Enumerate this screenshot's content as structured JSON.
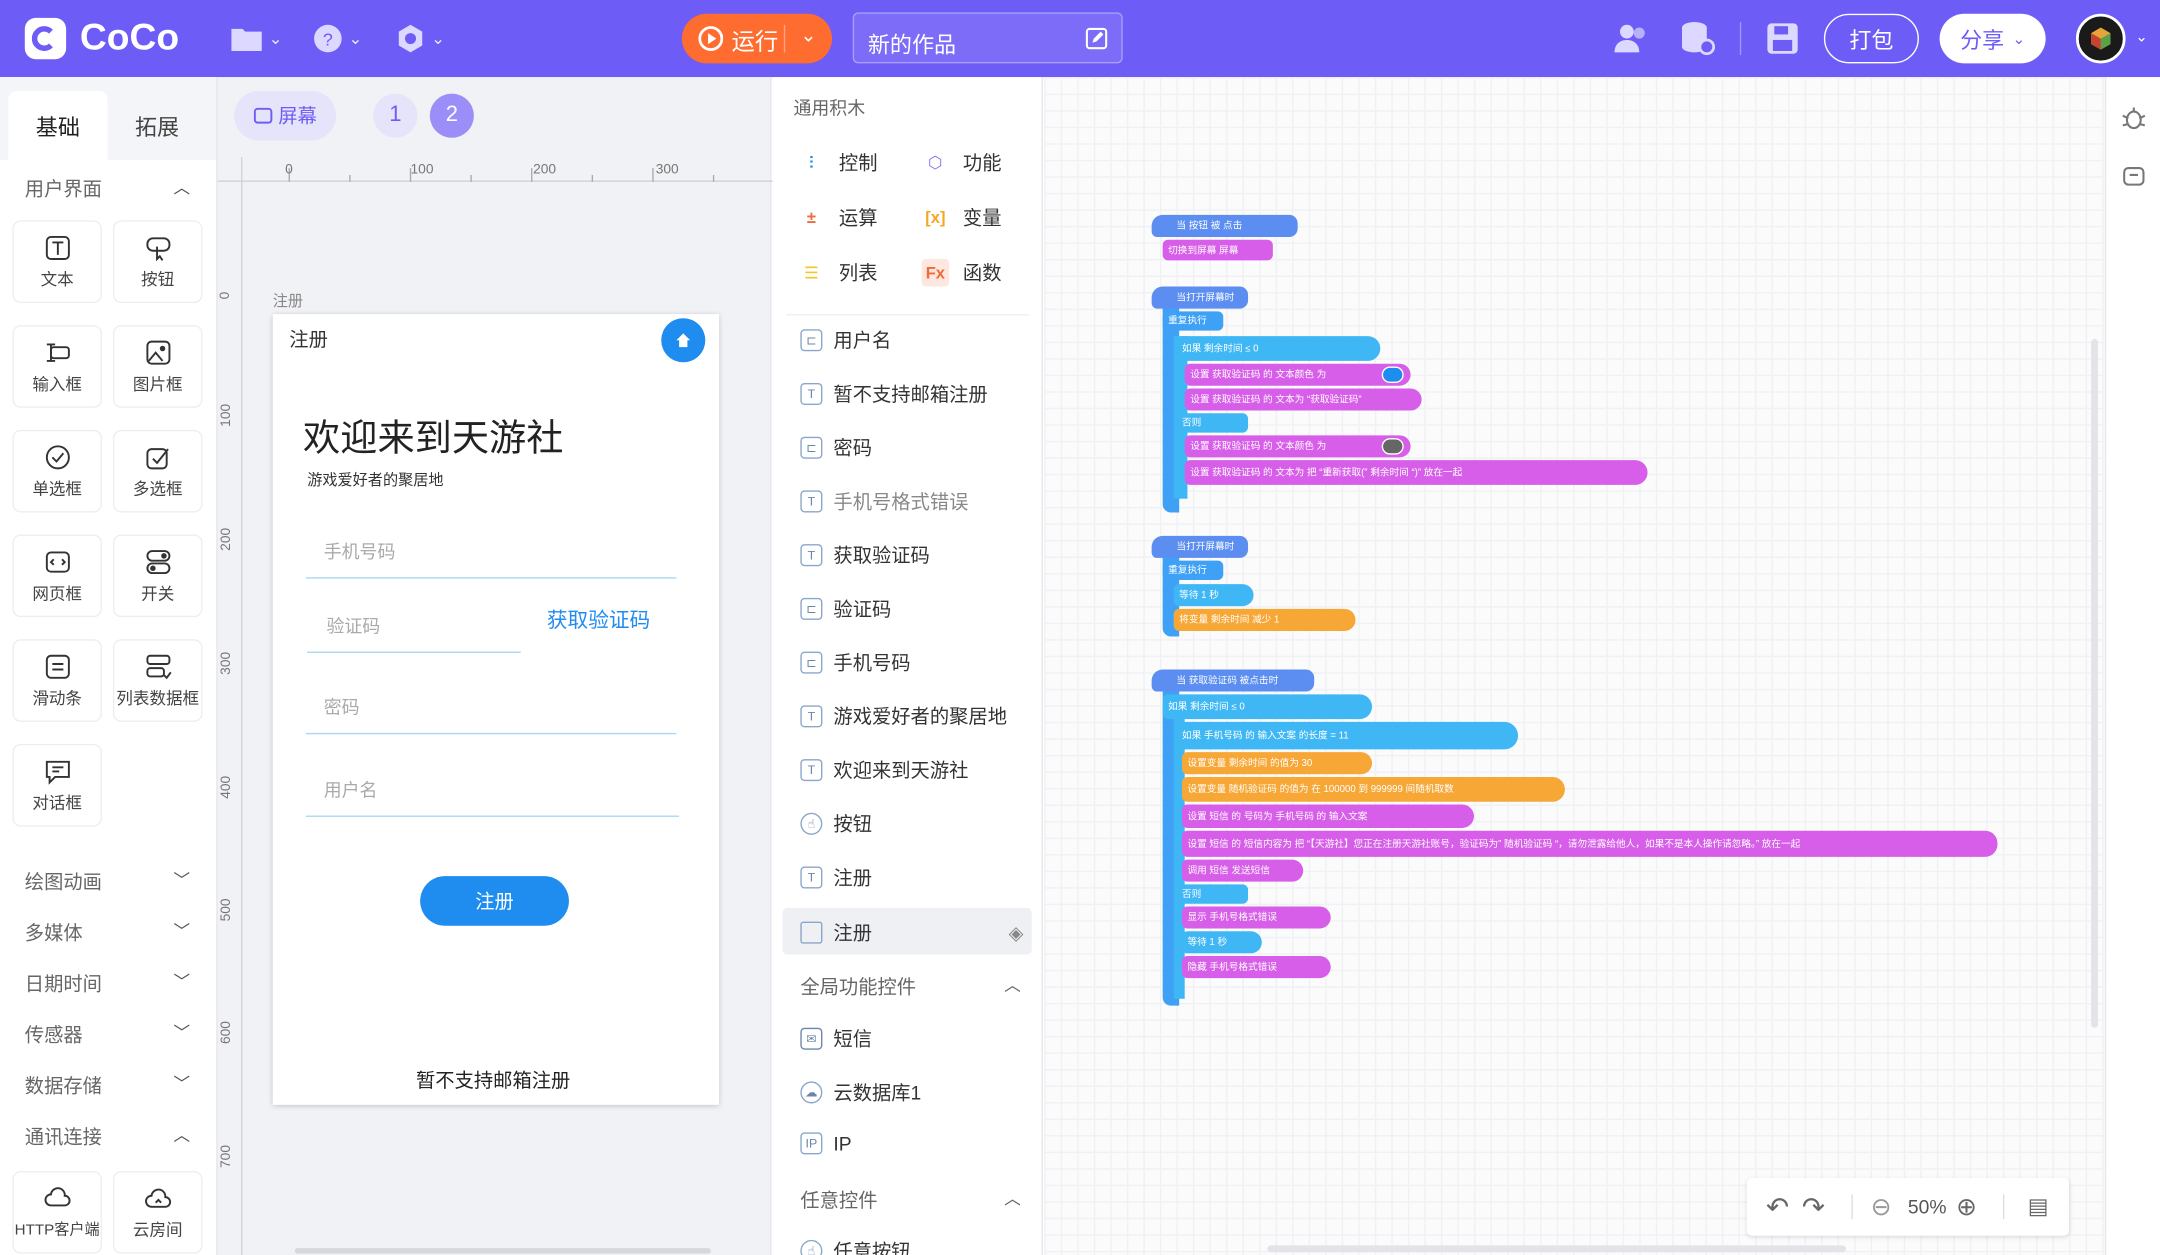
{
  "app": {
    "name": "CoCo"
  },
  "topbar": {
    "run_label": "运行",
    "project_title": "新的作品",
    "pack_label": "打包",
    "share_label": "分享"
  },
  "left_panel": {
    "tabs": [
      "基础",
      "拓展"
    ],
    "sections": {
      "ui": "用户界面",
      "draw": "绘图动画",
      "media": "多媒体",
      "datetime": "日期时间",
      "sensor": "传感器",
      "storage": "数据存储",
      "network": "通讯连接"
    },
    "components": [
      "文本",
      "按钮",
      "输入框",
      "图片框",
      "单选框",
      "多选框",
      "网页框",
      "开关",
      "滑动条",
      "列表数据框",
      "对话框"
    ],
    "network_components": [
      "HTTP客户端",
      "云房间"
    ]
  },
  "canvas": {
    "screen_label": "屏幕",
    "pages": [
      "1",
      "2"
    ],
    "ruler_h": [
      "0",
      "100",
      "200",
      "300"
    ],
    "ruler_v": [
      "0",
      "100",
      "200",
      "300",
      "400",
      "500",
      "600",
      "700"
    ],
    "screen_name": "注册"
  },
  "phone": {
    "header_title": "注册",
    "welcome": "欢迎来到天游社",
    "subtitle": "游戏爱好者的聚居地",
    "phone_placeholder": "手机号码",
    "code_placeholder": "验证码",
    "get_code": "获取验证码",
    "password_placeholder": "密码",
    "username_placeholder": "用户名",
    "register_button": "注册",
    "email_note": "暂不支持邮箱注册"
  },
  "blocks_panel": {
    "header": "通用积木",
    "categories": [
      "控制",
      "功能",
      "运算",
      "变量",
      "列表",
      "函数"
    ],
    "items": [
      "用户名",
      "暂不支持邮箱注册",
      "密码",
      "手机号格式错误",
      "获取验证码",
      "验证码",
      "手机号码",
      "游戏爱好者的聚居地",
      "欢迎来到天游社",
      "按钮",
      "注册",
      "注册"
    ],
    "global_section": "全局功能控件",
    "global_items": [
      "短信",
      "云数据库1",
      "IP"
    ],
    "any_section": "任意控件",
    "any_items": [
      "任意按钮"
    ]
  },
  "workspace": {
    "zoom": "50%",
    "scripts": [
      {
        "lines": [
          "当 按钮 被 点击",
          "切换到屏幕 屏幕"
        ]
      },
      {
        "lines": [
          "当打开屏幕时",
          "重复执行",
          "如果 剩余时间 ≤ 0",
          "设置 获取验证码 的 文本颜色 为",
          "设置 获取验证码 的 文本为 “获取验证码”",
          "否则",
          "设置 获取验证码 的 文本颜色 为",
          "设置 获取验证码 的 文本为 把 “重新获取(” 剩余时间 “)” 放在一起"
        ]
      },
      {
        "lines": [
          "当打开屏幕时",
          "重复执行",
          "等待 1 秒",
          "将变量 剩余时间 减少 1"
        ]
      },
      {
        "lines": [
          "当 获取验证码 被点击时",
          "如果 剩余时间 ≤ 0",
          "如果 手机号码 的 输入文案 的长度 = 11",
          "设置变量 剩余时间 的值为 30",
          "设置变量 随机验证码 的值为 在 100000 到 999999 间随机取数",
          "设置 短信 的 号码为 手机号码 的 输入文案",
          "设置 短信 的 短信内容为 把 “【天游社】您正在注册天游社账号，验证码为” 随机验证码 “，请勿泄露给他人，如果不是本人操作请忽略。” 放在一起",
          "调用 短信 发送短信",
          "否则",
          "显示 手机号格式错误",
          "等待 1 秒",
          "隐藏 手机号格式错误"
        ]
      }
    ]
  }
}
